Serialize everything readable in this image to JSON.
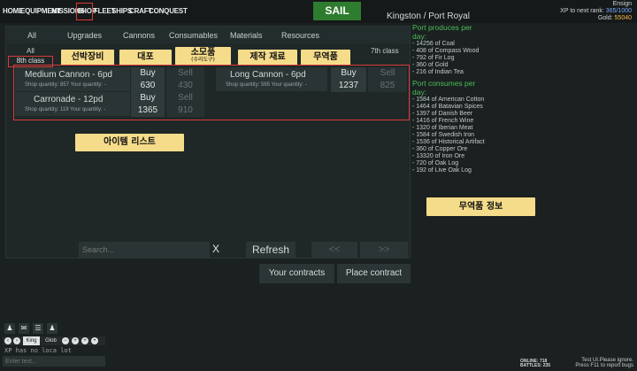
{
  "nav": {
    "items": [
      "HOME",
      "EQUIPMENT",
      "MISSIONS",
      "SHOP",
      "FLEET",
      "SHIPS",
      "CRAFT",
      "CONQUEST"
    ],
    "sail_label": "SAIL",
    "location": "Kingston / Port Royal"
  },
  "player": {
    "rank": "Ensign",
    "xp_label": "XP to next rank:",
    "xp_value": "365/1000",
    "gold_label": "Gold:",
    "gold_value": "55040"
  },
  "shop": {
    "tabs": [
      "All",
      "Upgrades",
      "Cannons",
      "Consumables",
      "Materials",
      "Resources"
    ],
    "subtab_all": "All",
    "selected_class": "8th class",
    "class_right": "7th class",
    "items": [
      {
        "name": "Medium Cannon - 6pd",
        "meta": "Shop quantity: 857  Your quantity: -",
        "buy_label": "Buy",
        "buy_price": "630",
        "sell_label": "Sell",
        "sell_price": "430"
      },
      {
        "name": "Long Cannon - 6pd",
        "meta": "Shop quantity: 565  Your quantity: -",
        "buy_label": "Buy",
        "buy_price": "1237",
        "sell_label": "Sell",
        "sell_price": "825"
      },
      {
        "name": "Carronade - 12pd",
        "meta": "Shop quantity: 119  Your quantity: -",
        "buy_label": "Buy",
        "buy_price": "1365",
        "sell_label": "Sell",
        "sell_price": "910"
      }
    ],
    "search_placeholder": "Search...",
    "search_clear": "X",
    "refresh_label": "Refresh",
    "prev_label": "<<",
    "next_label": ">>",
    "your_contracts_label": "Your contracts",
    "place_contract_label": "Place contract"
  },
  "annotations": {
    "upgrades": "선박장비",
    "cannons": "대포",
    "consumables": "소모품",
    "consumables_sub": "(수리도구)",
    "materials": "제작 재료",
    "resources": "무역품",
    "item_list": "아이템 리스트",
    "trade_info": "무역품 정보"
  },
  "port": {
    "produces_title": "Port produces per day:",
    "produces": [
      "- 14256 of Coal",
      "- 408 of Compass Wood",
      "- 792 of Fir Log",
      "- 360 of Gold",
      "- 216 of Indian Tea"
    ],
    "consumes_title": "Port consumes per day:",
    "consumes": [
      "- 1584 of American Cotton",
      "- 1464 of Batavian Spices",
      "- 1397 of Danish Beer",
      "- 1416 of French Wine",
      "- 1320 of Iberian Meat",
      "- 1584 of Swedish Iron",
      "- 1536 of Historical Artifact",
      "- 360 of Copper Ore",
      "- 13320 of Iron Ore",
      "- 720 of Oak Log",
      "- 192 of Live Oak Log"
    ]
  },
  "chat": {
    "channel": "King",
    "channel2": "Glob",
    "message": "XP has no loca lot",
    "input_placeholder": "Enter text..."
  },
  "status": {
    "online_line1": "ONLINE: 718",
    "online_line2": "BATTLES: 235",
    "notice_line1": "Test UI.Please ignore.",
    "notice_line2": "Press F11 to report bugs"
  }
}
